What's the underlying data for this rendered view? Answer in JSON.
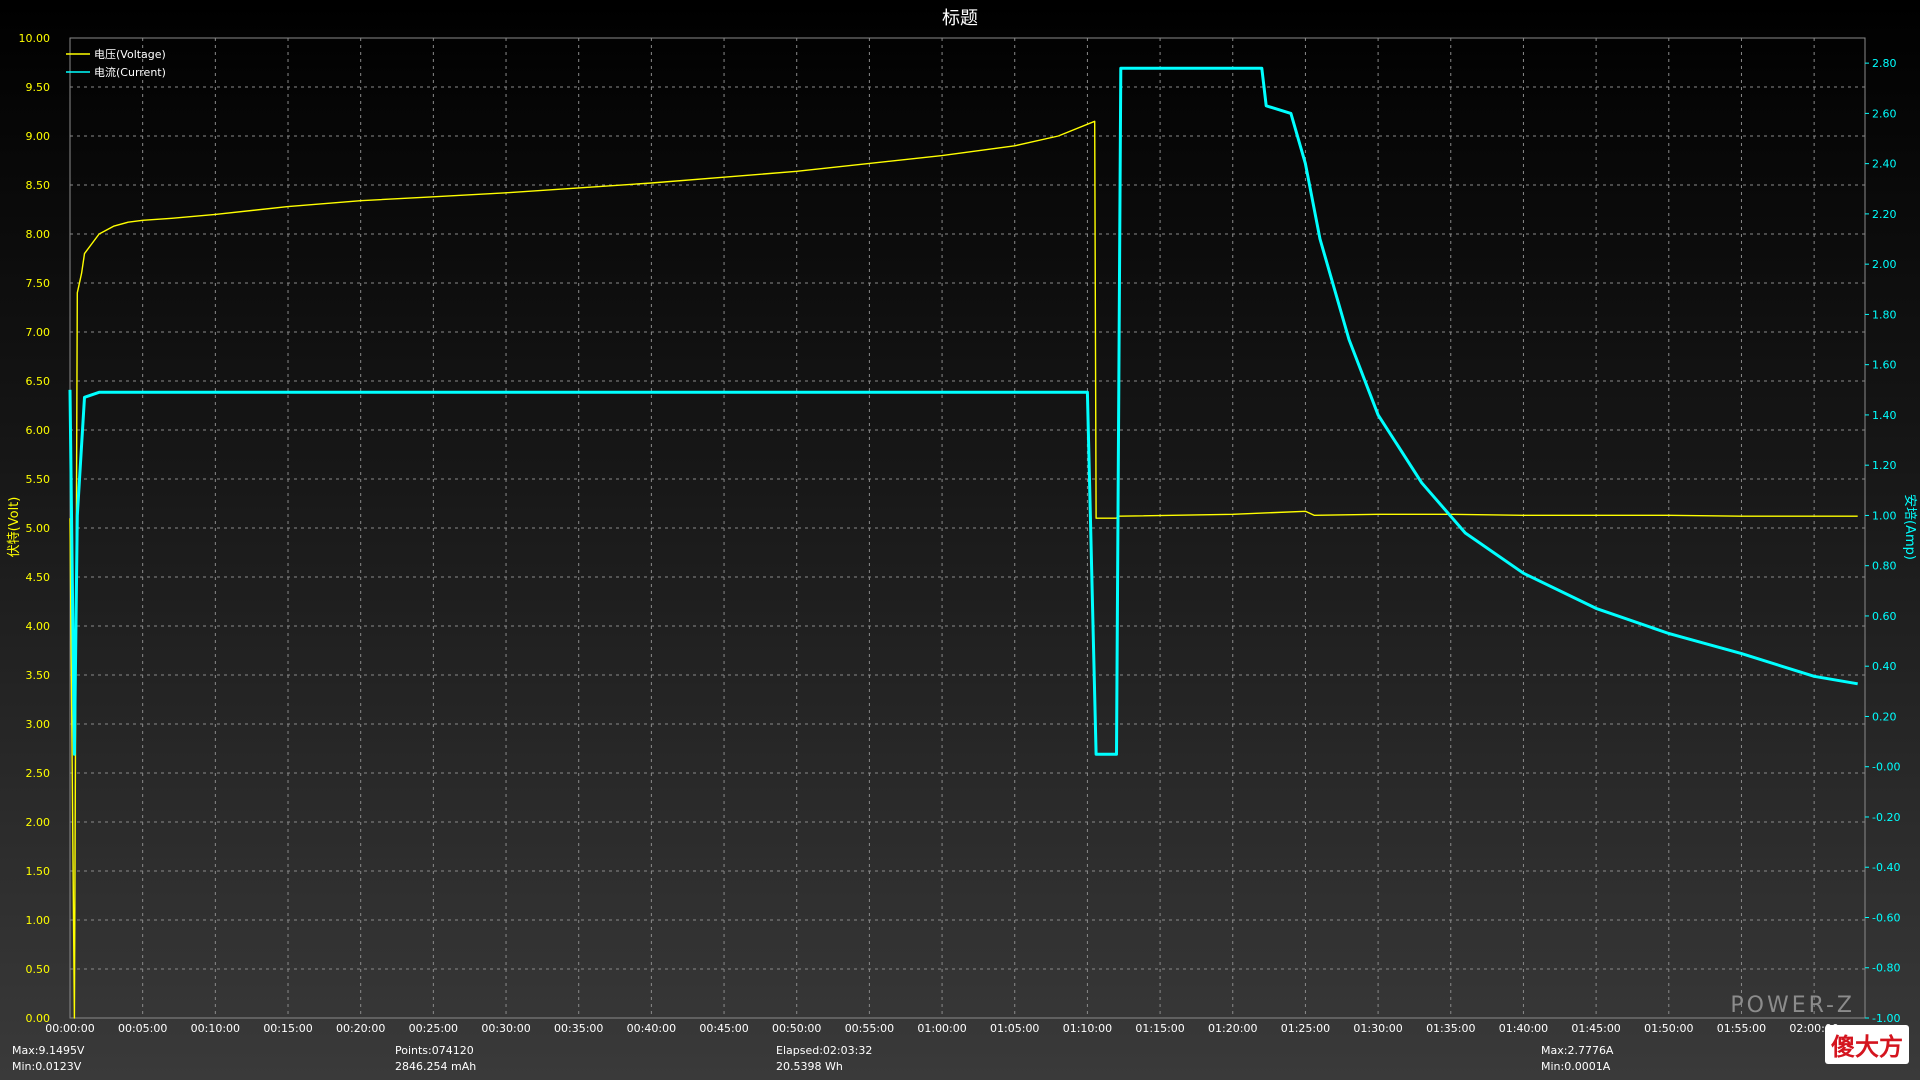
{
  "chart_data": {
    "type": "line",
    "title": "标题",
    "ylabel_left": "伏特(Volt)",
    "ylabel_right": "安培(Amp)",
    "left_axis": {
      "min": 0,
      "max": 10,
      "step": 0.5,
      "ticks": [
        "0.00",
        "0.50",
        "1.00",
        "1.50",
        "2.00",
        "2.50",
        "3.00",
        "3.50",
        "4.00",
        "4.50",
        "5.00",
        "5.50",
        "6.00",
        "6.50",
        "7.00",
        "7.50",
        "8.00",
        "8.50",
        "9.00",
        "9.50",
        "10.00"
      ]
    },
    "right_axis": {
      "min": -1.0,
      "max": 2.9,
      "step": 0.2,
      "ticks": [
        "-1.00",
        "-0.80",
        "-0.60",
        "-0.40",
        "-0.20",
        "-0.00",
        "0.20",
        "0.40",
        "0.60",
        "0.80",
        "1.00",
        "1.20",
        "1.40",
        "1.60",
        "1.80",
        "2.00",
        "2.20",
        "2.40",
        "2.60",
        "2.80"
      ]
    },
    "x_axis": {
      "min_minutes": 0,
      "max_minutes": 123.5,
      "ticks": [
        "00:00:00",
        "00:05:00",
        "00:10:00",
        "00:15:00",
        "00:20:00",
        "00:25:00",
        "00:30:00",
        "00:35:00",
        "00:40:00",
        "00:45:00",
        "00:50:00",
        "00:55:00",
        "01:00:00",
        "01:05:00",
        "01:10:00",
        "01:15:00",
        "01:20:00",
        "01:25:00",
        "01:30:00",
        "01:35:00",
        "01:40:00",
        "01:45:00",
        "01:50:00",
        "01:55:00",
        "02:00:00"
      ]
    },
    "grid": true,
    "legend_position": "top-left",
    "series": [
      {
        "name": "电压(Voltage)",
        "axis": "left",
        "color": "#ffff00",
        "x_minutes": [
          0,
          0.3,
          0.5,
          0.8,
          1,
          2,
          3,
          4,
          5,
          7,
          10,
          15,
          20,
          25,
          30,
          35,
          40,
          45,
          50,
          55,
          60,
          65,
          68,
          70.5,
          70.6,
          72,
          72.1,
          80,
          85,
          85.6,
          90,
          95,
          100,
          105,
          110,
          115,
          120,
          123
        ],
        "values": [
          5.1,
          0.0,
          7.4,
          7.6,
          7.8,
          8.0,
          8.08,
          8.12,
          8.14,
          8.16,
          8.2,
          8.28,
          8.34,
          8.38,
          8.42,
          8.47,
          8.52,
          8.58,
          8.64,
          8.72,
          8.8,
          8.9,
          9.0,
          9.15,
          5.1,
          5.1,
          5.12,
          5.14,
          5.17,
          5.13,
          5.14,
          5.14,
          5.13,
          5.13,
          5.13,
          5.12,
          5.12,
          5.12
        ]
      },
      {
        "name": "电流(Current)",
        "axis": "right",
        "color": "#00ffff",
        "x_minutes": [
          0,
          0.3,
          0.5,
          1,
          2,
          5,
          10,
          20,
          30,
          40,
          50,
          60,
          65,
          70,
          70.6,
          72,
          72.3,
          80,
          82,
          82.3,
          84,
          85,
          86,
          88,
          90,
          93,
          96,
          100,
          105,
          110,
          115,
          120,
          123
        ],
        "values": [
          1.5,
          0.05,
          1.0,
          1.47,
          1.49,
          1.49,
          1.49,
          1.49,
          1.49,
          1.49,
          1.49,
          1.49,
          1.49,
          1.49,
          0.05,
          0.05,
          2.78,
          2.78,
          2.78,
          2.63,
          2.6,
          2.4,
          2.1,
          1.7,
          1.4,
          1.13,
          0.93,
          0.77,
          0.63,
          0.53,
          0.45,
          0.36,
          0.33
        ]
      }
    ],
    "stats": {
      "voltage_max": "Max:9.1495V",
      "voltage_min": "Min:0.0123V",
      "points": "Points:074120",
      "capacity_mah": "2846.254 mAh",
      "elapsed": "Elapsed:02:03:32",
      "energy_wh": "20.5398 Wh",
      "current_max": "Max:2.7776A",
      "current_min": "Min:0.0001A"
    },
    "logo_text": "POWER-Z",
    "watermark": "傻大方"
  }
}
